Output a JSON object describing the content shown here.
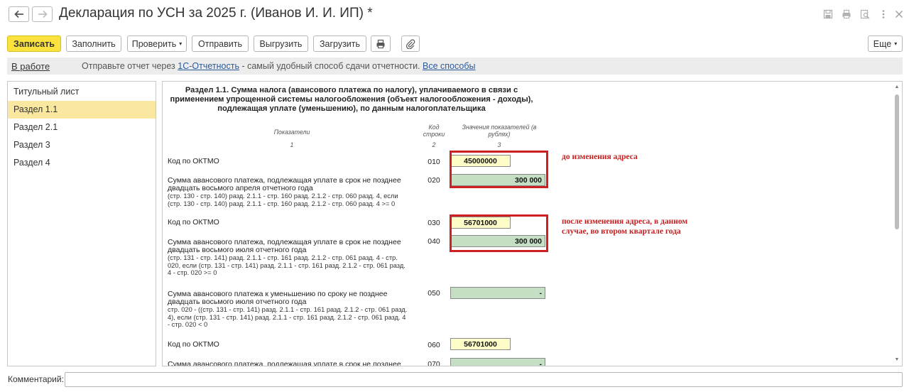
{
  "window": {
    "title": "Декларация по УСН за 2025 г. (Иванов И. И. ИП) *"
  },
  "toolbar": {
    "save_label": "Записать",
    "fill_label": "Заполнить",
    "check_label": "Проверить",
    "send_label": "Отправить",
    "export_label": "Выгрузить",
    "import_label": "Загрузить",
    "more_label": "Еще"
  },
  "infobar": {
    "status": "В работе",
    "message_prefix": "Отправьте отчет через",
    "link_1c": "1С-Отчетность",
    "message_suffix": "- самый удобный способ сдачи отчетности.",
    "link_all": "Все способы"
  },
  "sidebar": {
    "items": [
      {
        "label": "Титульный лист"
      },
      {
        "label": "Раздел 1.1"
      },
      {
        "label": "Раздел 2.1"
      },
      {
        "label": "Раздел 3"
      },
      {
        "label": "Раздел 4"
      }
    ],
    "active_index": 1
  },
  "document": {
    "title": "Раздел 1.1. Сумма налога (авансового платежа по налогу), уплачиваемого в связи с применением упрощенной системы налогообложения (объект налогообложения - доходы), подлежащая уплате (уменьшению), по данным налогоплательщика",
    "columns": {
      "indicators": "Показатели",
      "indicators_num": "1",
      "code": "Код строки",
      "code_num": "2",
      "values": "Значения показателей (в рублях)",
      "values_num": "3"
    },
    "rows": [
      {
        "label": "Код по ОКТМО",
        "sub": "",
        "code": "010",
        "value": "45000000"
      },
      {
        "label": "Сумма авансового платежа, подлежащая уплате в срок не позднее двадцать восьмого апреля отчетного года",
        "sub": "(стр. 130 - стр. 140) разд. 2.1.1 - стр. 160 разд. 2.1.2 - стр. 060 разд. 4, если (стр. 130 - стр. 140) разд. 2.1.1 - стр. 160 разд. 2.1.2 - стр. 060 разд. 4 >= 0",
        "code": "020",
        "value": "300 000"
      },
      {
        "label": "Код по ОКТМО",
        "sub": "",
        "code": "030",
        "value": "56701000"
      },
      {
        "label": "Сумма авансового платежа, подлежащая уплате в срок не позднее двадцать восьмого июля отчетного года",
        "sub": "(стр. 131 - стр. 141) разд. 2.1.1 - стр. 161 разд. 2.1.2 - стр. 061 разд. 4 - стр. 020, если (стр. 131 - стр. 141) разд. 2.1.1 - стр. 161 разд. 2.1.2 - стр. 061 разд. 4 - стр. 020 >= 0",
        "code": "040",
        "value": "300 000"
      },
      {
        "label": "Сумма авансового платежа к уменьшению по сроку не позднее двадцать восьмого июля отчетного года",
        "sub": "стр. 020 - ((стр. 131 - стр. 141) разд. 2.1.1 - стр. 161 разд. 2.1.2 - стр. 061 разд. 4), если (стр. 131 - стр. 141) разд. 2.1.1 - стр. 161 разд. 2.1.2 - стр. 061 разд. 4 - стр. 020 < 0",
        "code": "050",
        "value": "-"
      },
      {
        "label": "Код по ОКТМО",
        "sub": "",
        "code": "060",
        "value": "56701000"
      },
      {
        "label": "Сумма авансового платежа, подлежащая уплате в срок не позднее",
        "sub": "",
        "code": "070",
        "value": "-"
      }
    ],
    "annotations": {
      "before": "до изменения адреса",
      "after": "после изменения адреса, в данном случае, во втором квартале года"
    }
  },
  "comment": {
    "label": "Комментарий:",
    "value": ""
  },
  "icons": [
    "arrow-left-icon",
    "arrow-right-icon",
    "save-icon",
    "print-icon",
    "preview-icon",
    "more-vertical-icon",
    "close-icon",
    "print-icon",
    "paperclip-icon"
  ]
}
